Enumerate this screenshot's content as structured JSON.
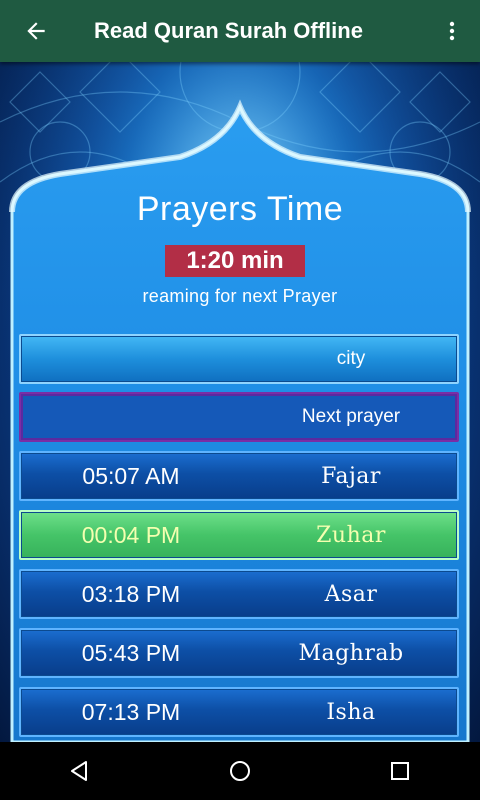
{
  "appbar": {
    "title": "Read Quran Surah Offline",
    "back_icon": "arrow-left-icon",
    "menu_icon": "more-vertical-icon"
  },
  "main": {
    "heading": "Prayers Time",
    "timer": "1:20 min",
    "remaining_text": "reaming for next Prayer",
    "city_label": "city",
    "next_prayer_label": "Next prayer",
    "prayers": [
      {
        "time": "05:07 AM",
        "name": "Fajar",
        "active": false
      },
      {
        "time": "00:04 PM",
        "name": "Zuhar",
        "active": true
      },
      {
        "time": "03:18 PM",
        "name": "Asar",
        "active": false
      },
      {
        "time": "05:43 PM",
        "name": "Maghrab",
        "active": false
      },
      {
        "time": "07:13 PM",
        "name": "Isha",
        "active": false
      }
    ]
  },
  "colors": {
    "appbar": "#1f5a41",
    "timer_badge": "#b22e46",
    "active_row": "#45c468",
    "row_blue": "#0d4fa6"
  },
  "navbar": {
    "icons": [
      "nav-back-icon",
      "nav-home-icon",
      "nav-recents-icon"
    ]
  }
}
